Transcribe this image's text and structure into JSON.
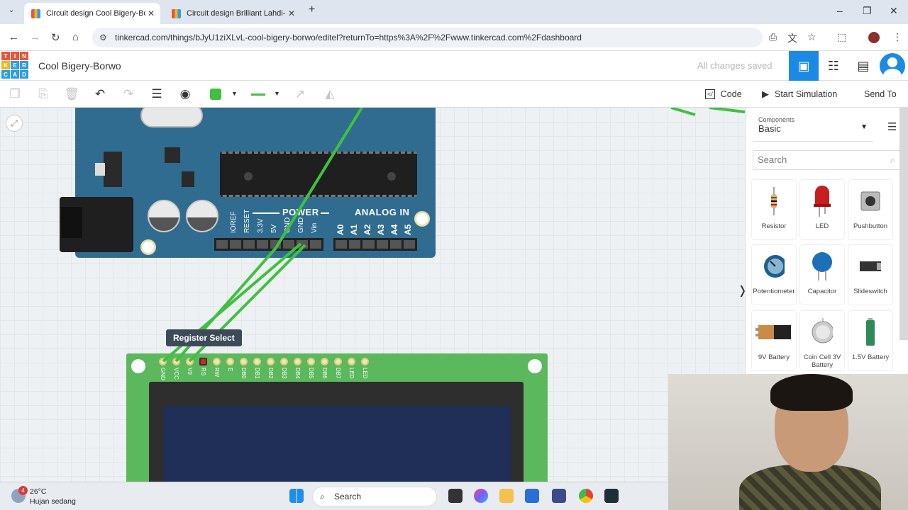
{
  "browser": {
    "tabs": [
      {
        "title": "Circuit design Cool Bigery-Borwo",
        "active": true
      },
      {
        "title": "Circuit design Brilliant Lahdi-Bo",
        "active": false
      }
    ],
    "new_tab": "+",
    "url": "tinkercad.com/things/bJyU1ziXLvL-cool-bigery-borwo/editel?returnTo=https%3A%2F%2Fwww.tinkercad.com%2Fdashboard"
  },
  "app": {
    "logo_letters": [
      "TIN",
      "KER",
      "CAD"
    ],
    "project_title": "Cool Bigery-Borwo",
    "save_status": "All changes saved"
  },
  "toolbar": {
    "code_label": "Code",
    "start_sim_label": "Start Simulation",
    "send_to_label": "Send To",
    "wire_color": "#40c040"
  },
  "canvas": {
    "tooltip": "Register Select",
    "arduino": {
      "power_label": "POWER",
      "analog_label": "ANALOG IN",
      "power_pins": [
        "IOREF",
        "RESET",
        "3.3V",
        "5V",
        "GND",
        "GND",
        "Vin"
      ],
      "analog_pins": [
        "A0",
        "A1",
        "A2",
        "A3",
        "A4",
        "A5"
      ]
    },
    "lcd_pins": [
      "GND",
      "VCC",
      "V0",
      "RS",
      "RW",
      "E",
      "DB0",
      "DB1",
      "DB2",
      "DB3",
      "DB4",
      "DB5",
      "DB6",
      "DB7",
      "LED",
      "LED"
    ]
  },
  "panel": {
    "dropdown_label": "Components",
    "dropdown_value": "Basic",
    "search_placeholder": "Search",
    "components": [
      "Resistor",
      "LED",
      "Pushbutton",
      "Potentiometer",
      "Capacitor",
      "Slideswitch",
      "9V Battery",
      "Coin Cell 3V Battery",
      "1.5V Battery"
    ]
  },
  "taskbar": {
    "weather_badge": "4",
    "temperature": "26°C",
    "condition": "Hujan sedang",
    "search_label": "Search"
  },
  "colors": {
    "accent": "#1b8ae4",
    "wire": "#40c040",
    "arduino": "#2f6c8f",
    "lcd_board": "#5cb85c"
  }
}
